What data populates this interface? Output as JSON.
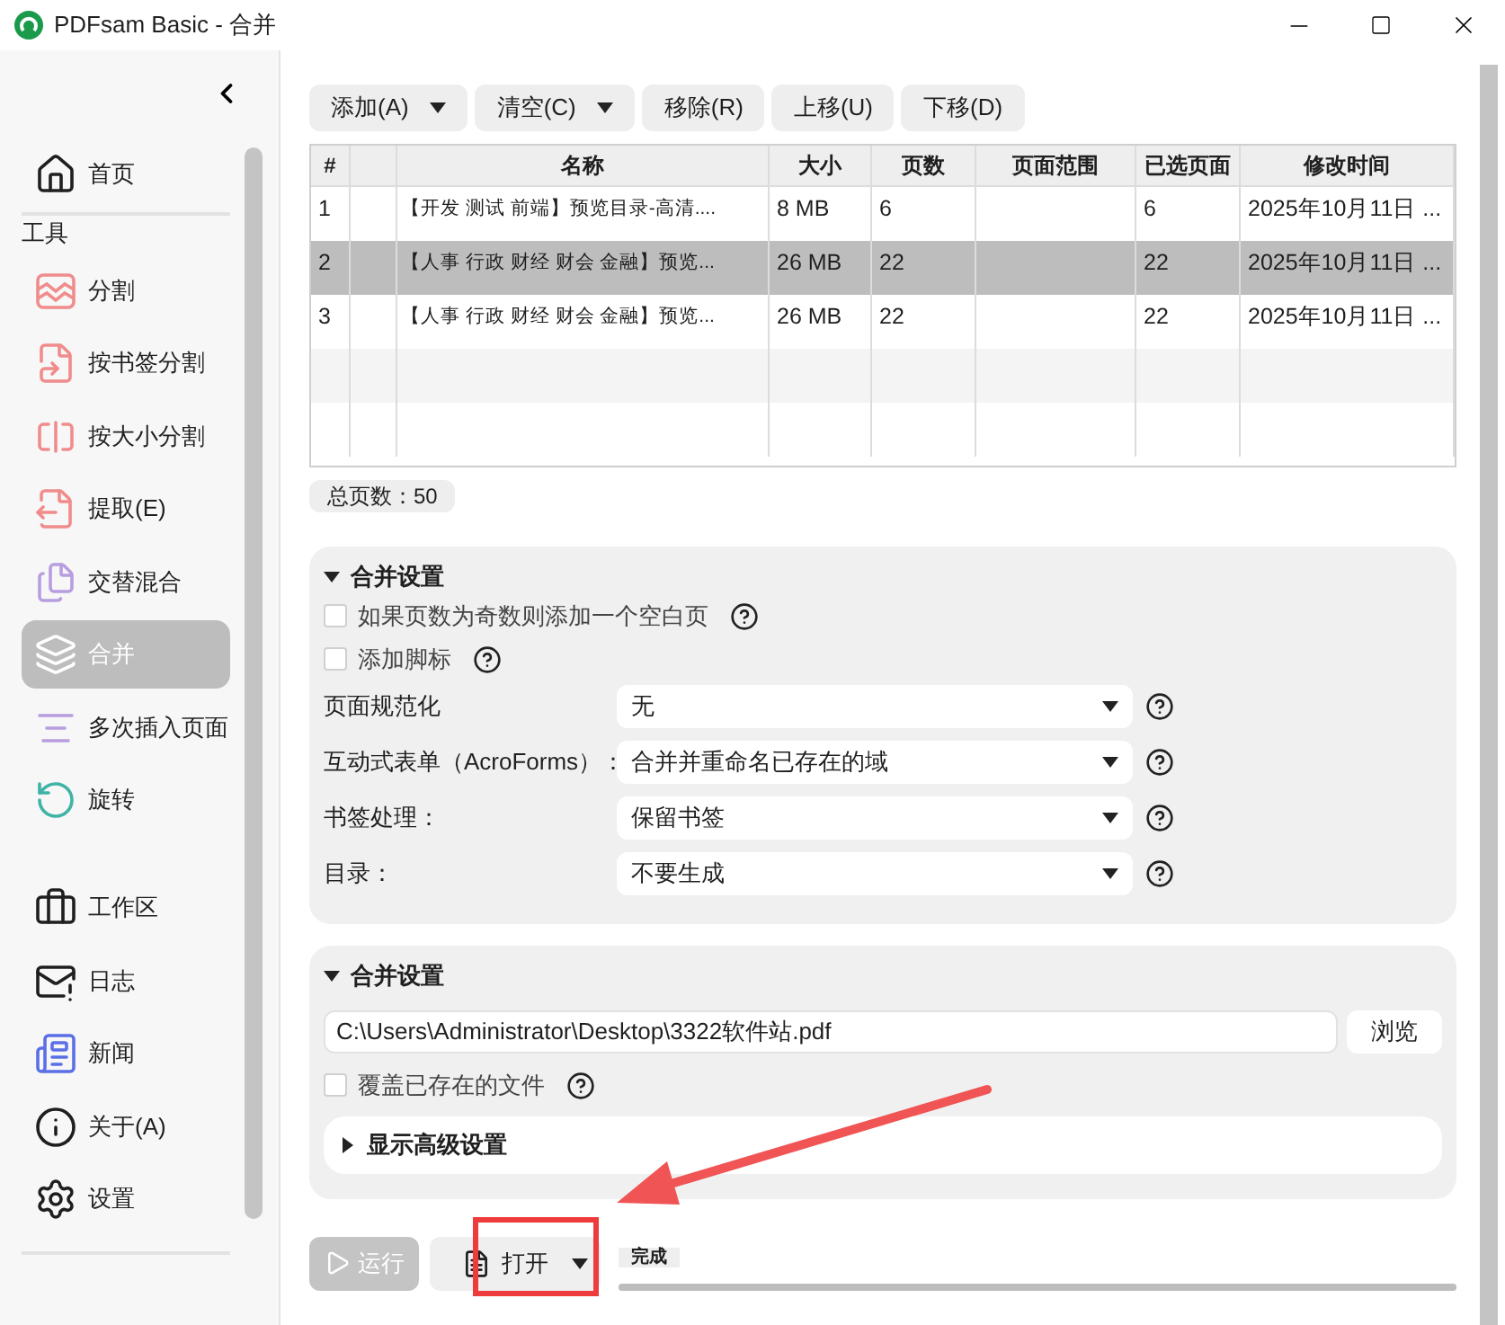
{
  "window": {
    "title": "PDFsam Basic - 合并"
  },
  "sidebar": {
    "section_label": "工具",
    "home": [
      {
        "label": "首页",
        "selected": false
      }
    ],
    "tools": [
      {
        "label": "分割",
        "selected": false
      },
      {
        "label": "按书签分割",
        "selected": false
      },
      {
        "label": "按大小分割",
        "selected": false
      },
      {
        "label": "提取(E)",
        "selected": false
      },
      {
        "label": "交替混合",
        "selected": false
      },
      {
        "label": "合并",
        "selected": true
      },
      {
        "label": "多次插入页面",
        "selected": false
      },
      {
        "label": "旋转",
        "selected": false
      }
    ],
    "bottom": [
      {
        "label": "工作区",
        "selected": false
      },
      {
        "label": "日志",
        "selected": false
      },
      {
        "label": "新闻",
        "selected": false
      },
      {
        "label": "关于(A)",
        "selected": false
      },
      {
        "label": "设置",
        "selected": false
      }
    ]
  },
  "toolbar": [
    {
      "label": "添加(A)",
      "dropdown": true
    },
    {
      "label": "清空(C)",
      "dropdown": true
    },
    {
      "label": "移除(R)",
      "dropdown": false
    },
    {
      "label": "上移(U)",
      "dropdown": false
    },
    {
      "label": "下移(D)",
      "dropdown": false
    }
  ],
  "table": {
    "columns": [
      "#",
      "",
      "名称",
      "大小",
      "页数",
      "页面范围",
      "已选页面",
      "修改时间"
    ],
    "rows": [
      {
        "selected": false,
        "cells": [
          "1",
          "",
          "【开发 测试 前端】预览目录-高清....",
          "8 MB",
          "6",
          "",
          "6",
          "2025年10月11日 ..."
        ]
      },
      {
        "selected": true,
        "cells": [
          "2",
          "",
          "【人事 行政 财经 财会 金融】预览...",
          "26 MB",
          "22",
          "",
          "22",
          "2025年10月11日 ..."
        ]
      },
      {
        "selected": false,
        "cells": [
          "3",
          "",
          "【人事 行政 财经 财会 金融】预览...",
          "26 MB",
          "22",
          "",
          "22",
          "2025年10月11日 ..."
        ]
      }
    ]
  },
  "total_pages": "总页数：50",
  "merge_settings": {
    "title": "合并设置",
    "expanded": true,
    "options": [
      {
        "kind": "checkbox",
        "label": "如果页数为奇数则添加一个空白页",
        "checked": false
      },
      {
        "kind": "checkbox",
        "label": "添加脚标",
        "checked": false
      },
      {
        "kind": "select",
        "label": "页面规范化",
        "value": "无"
      },
      {
        "kind": "select",
        "label": "互动式表单（AcroForms）：",
        "value": "合并并重命名已存在的域"
      },
      {
        "kind": "select",
        "label": "书签处理：",
        "value": "保留书签"
      },
      {
        "kind": "select",
        "label": "目录：",
        "value": "不要生成"
      }
    ]
  },
  "output": {
    "title": "合并设置",
    "expanded": true,
    "path": "C:\\Users\\Administrator\\Desktop\\3322软件站.pdf",
    "browse": "浏览",
    "overwrite": {
      "label": "覆盖已存在的文件",
      "checked": false
    },
    "advanced": {
      "label": "显示高级设置",
      "expanded": false
    }
  },
  "footer": {
    "run": {
      "label": "运行",
      "disabled": true
    },
    "open": {
      "label": "打开"
    },
    "status": "完成",
    "level": 1
  }
}
